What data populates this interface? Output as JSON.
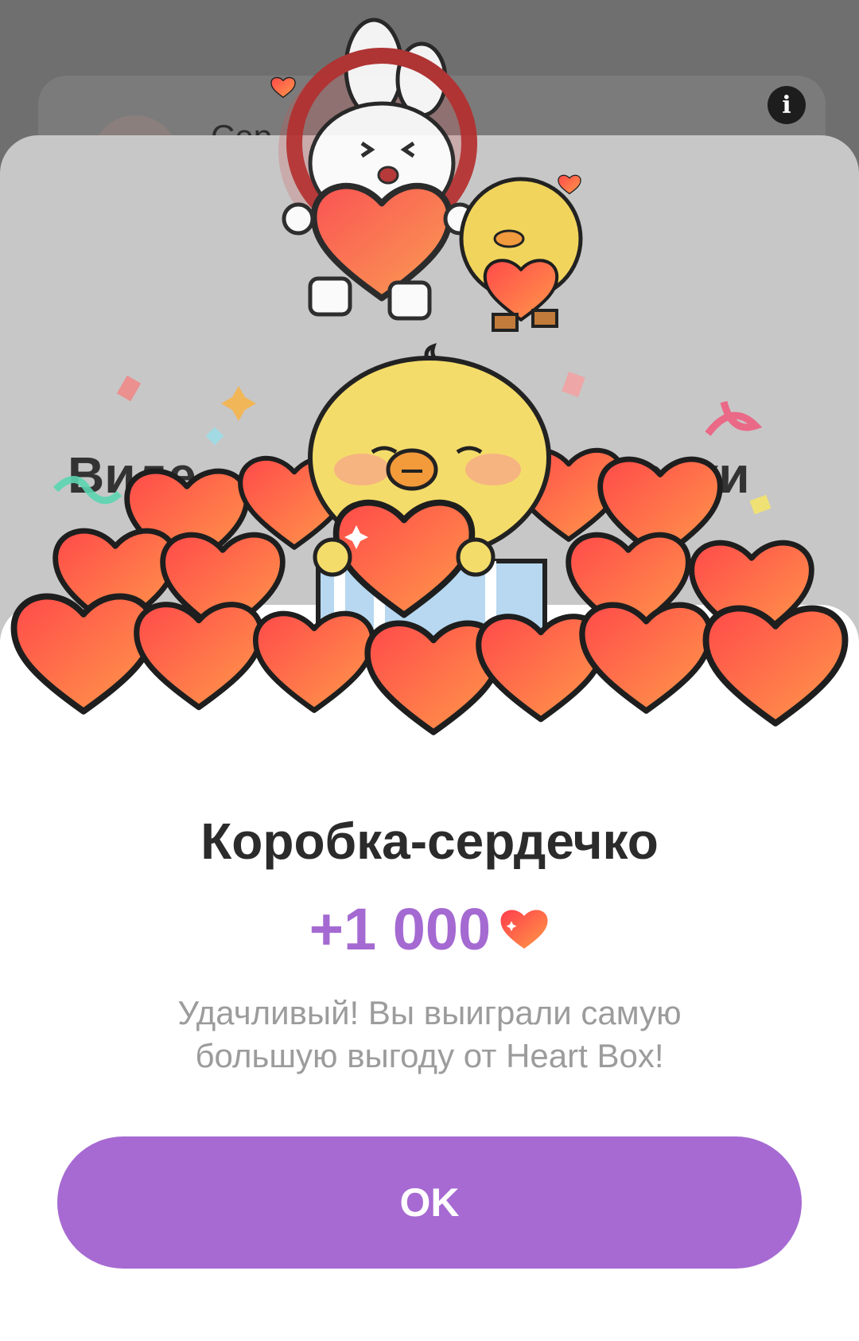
{
  "background": {
    "card_text": "Сер",
    "heading_left": "Виде",
    "heading_right": "ечки"
  },
  "modal": {
    "title": "Коробка-сердечко",
    "amount": "+1 000",
    "description": "Удачливый! Вы выиграли самую большую выгоду от Heart Box!",
    "ok_label": "OK"
  },
  "colors": {
    "accent": "#a66ad2",
    "amount": "#a46ad2",
    "heart": "#f4613f",
    "title": "#2b2b2b",
    "muted": "#9c9c9c"
  },
  "icons": [
    "info-icon",
    "heart-icon"
  ]
}
